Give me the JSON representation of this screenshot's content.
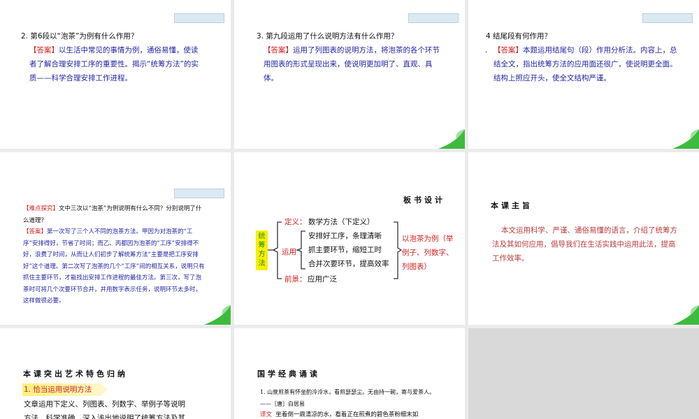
{
  "slides": [
    {
      "question": "2. 第6段以“泡茶”为例有什么作用？",
      "answer_tag": "【答案】",
      "answer": "以生活中常见的事情为例，通俗易懂，使读者了解合理安排工序的重要性。揭示“统筹方法”的实质——科学合理安排工作进程。"
    },
    {
      "question": "3. 第九段运用了什么说明方法有什么作用？",
      "answer_tag": "【答案】",
      "answer": "运用了列图表的说明方法，将泡茶的各个环节用图表的形式呈现出来，使说明更加明了、直观、具体。"
    },
    {
      "question": "4  结尾段有何作用？",
      "bullet": ".",
      "answer_tag": "【答案】",
      "answer": "本题运用结尾句（段）作用分析法。内容上，总结全文，指出统筹方法的应用面还很广，使说明更全面。结构上照应开头，使全文结构严谨。"
    },
    {
      "tag": "【难点探究】",
      "question": "文中三次以“泡茶”为例说明有什么不同？分别说明了什么道理？",
      "answer_tag": "【答案】",
      "answer": "第一次写了三个人不同的泡茶方法。甲因为对泡茶的“工序”安排得好，节省了时间；而乙、丙都因为泡茶的“工序”安排得不好，浪费了时间，从而让人们初步了解统筹方法“主要是把工序安排好”这个道理。第二次写了泡茶的几个“工序”间的相互关系，说明只有抓住主要环节，才能找出安排工作进程的最佳方法。第三次，写了泡茶时可将几个次要环节合并，并用数字表示任务，说明环节太多时，这样做很必要。"
    },
    {
      "title": "板书设计",
      "root": "统筹方法",
      "def_label": "定义：",
      "def": "数学方法（下定义）",
      "use_label": "运用",
      "use_items": [
        "安排好工序，条理清晰",
        "抓主要环节，缩短工时",
        "合并次要环节，提高效率"
      ],
      "future_label": "前景：",
      "future": "应用广泛",
      "right": "以泡茶为例（举例子、列数字、列图表）"
    },
    {
      "title": "本课主旨",
      "body": "本文运用科学、严谨、通俗易懂的语言，介绍了统筹方法及其如何应用，倡导我们在生活实践中运用此法，提高工作效率。"
    },
    {
      "title": "本课突出艺术特色归纳",
      "point": "1. 恰当运用说明方法",
      "body": "文章运用下定义、列图表、列数字、举例子等说明方法，科学准确、深入浅出地说明了统筹方法及其工作原"
    },
    {
      "title": "国学经典诵读",
      "item": "1. 山泉煎茶有怀坐酌泠泠水，看煎瑟瑟尘。无由持一碗，寄与爱茶人。——［唐］白居易",
      "trans_label": "译文",
      "trans": "坐着倒一鼎清凉的水，看着正在煎煮的碧色茶粉细末如"
    }
  ],
  "colors": {
    "answer": "#2424a8",
    "highlight": "#d42020",
    "gap": "#ebebeb"
  }
}
